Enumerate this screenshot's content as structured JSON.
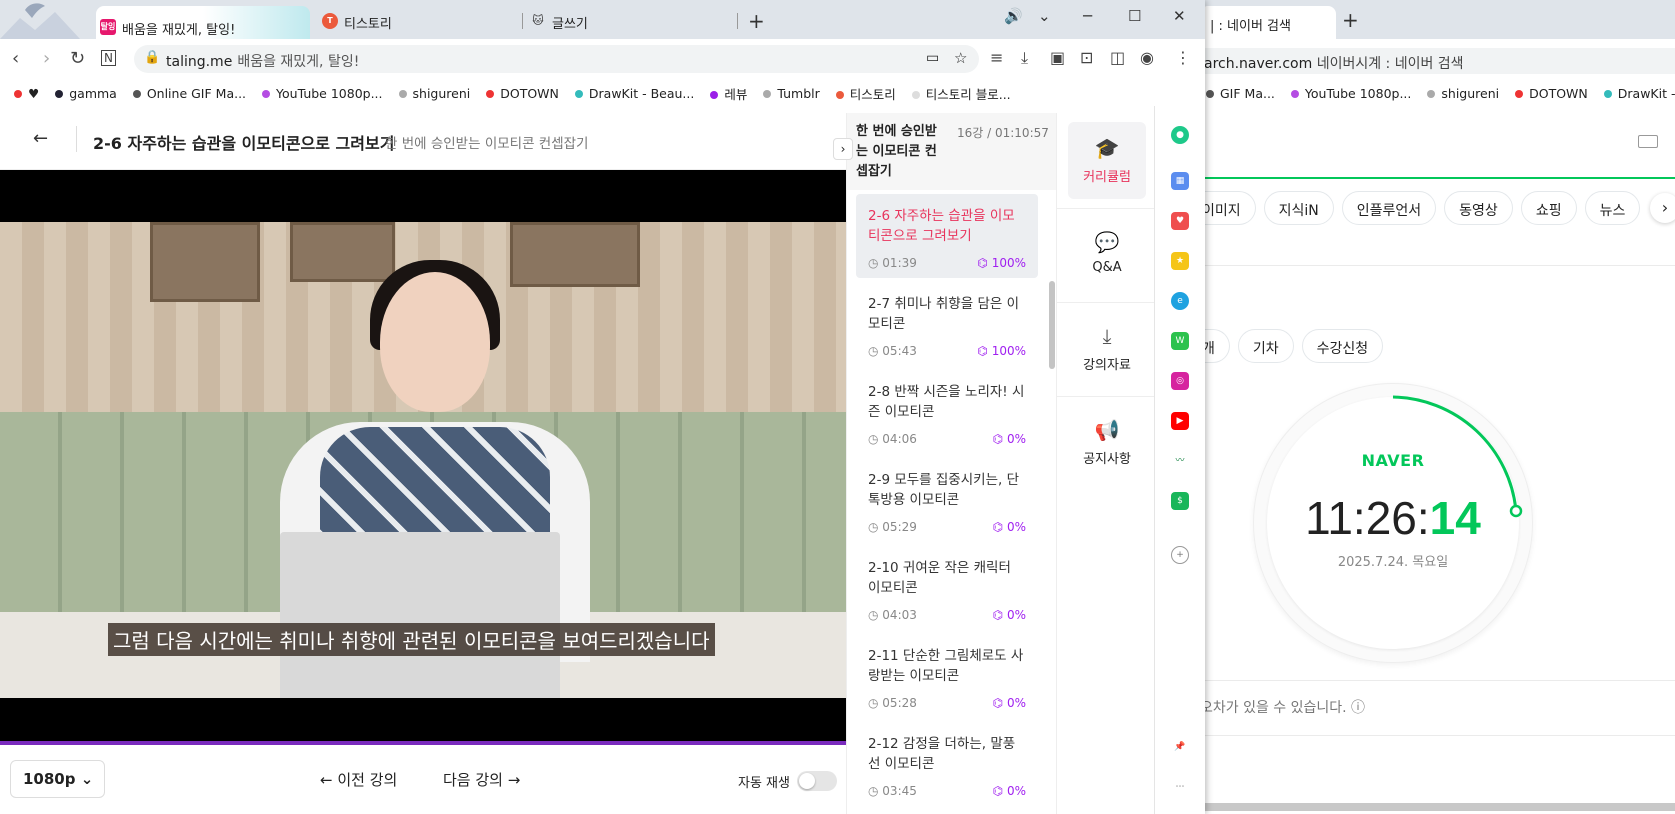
{
  "back_window": {
    "tab_title": "| : 네이버 검색",
    "url_host": "arch.naver.com",
    "url_title": "네이버시계 : 네이버 검색",
    "bookmarks": [
      {
        "label": "GIF Ma...",
        "color": "#555"
      },
      {
        "label": "YouTube 1080p...",
        "color": "#b54de3"
      },
      {
        "label": "shigureni",
        "color": "#aaa"
      },
      {
        "label": "DOTOWN",
        "color": "#e33"
      },
      {
        "label": "DrawKit - Beau...",
        "color": "#3bb"
      }
    ],
    "search_tabs": [
      "이미지",
      "지식iN",
      "인플루언서",
      "동영상",
      "쇼핑",
      "뉴스"
    ],
    "chips2": [
      "개",
      "기차",
      "수강신청"
    ],
    "clock": {
      "brand": "NAVER",
      "hm": "11:26:",
      "sec": "14",
      "date": "2025.7.24. 목요일"
    },
    "notice": "오차가 있을 수 있습니다. ⓘ"
  },
  "tabs": [
    {
      "label": "배움을 재밌게, 탈잉!",
      "fav": "탈잉",
      "color": "#e6186d"
    },
    {
      "label": "티스토리",
      "fav": "T",
      "color": "#eb5a3c"
    },
    {
      "label": "글쓰기",
      "fav": "🐱",
      "color": "#fff"
    }
  ],
  "addr": {
    "host": "taling.me",
    "title": "배움을 재밌게, 탈잉!"
  },
  "bookmarks": [
    {
      "label": "",
      "color": "#e33"
    },
    {
      "label": "♥",
      "color": "#222"
    },
    {
      "label": "gamma",
      "color": "#222"
    },
    {
      "label": "Online GIF Ma...",
      "color": "#555"
    },
    {
      "label": "YouTube 1080p...",
      "color": "#b54de3"
    },
    {
      "label": "shigureni",
      "color": "#aaa"
    },
    {
      "label": "DOTOWN",
      "color": "#e33"
    },
    {
      "label": "DrawKit - Beau...",
      "color": "#3bb"
    },
    {
      "label": "레뷰",
      "color": "#9b1fe8"
    },
    {
      "label": "Tumblr",
      "color": "#aaa"
    },
    {
      "label": "티스토리",
      "color": "#eb5a3c"
    },
    {
      "label": "티스토리 블로...",
      "color": "#ddd"
    }
  ],
  "lecture": {
    "title": "2-6 자주하는 습관을 이모티콘으로 그려보기",
    "subtitle": "한 번에 승인받는 이모티콘 컨셉잡기",
    "caption": "그럼 다음 시간에는 취미나 취향에 관련된 이모티콘을 보여드리겠습니다",
    "quality": "1080p",
    "prev": "이전 강의",
    "next": "다음 강의",
    "autoplay": "자동 재생"
  },
  "lesson_panel": {
    "course": "한 번에 승인받는 이모티콘 컨셉잡기",
    "count": "16강 / 01:10:57",
    "lessons": [
      {
        "title": "2-6 자주하는 습관을 이모티콘으로 그려보기",
        "time": "01:39",
        "pct": "100%"
      },
      {
        "title": "2-7 취미나 취향을 담은 이모티콘",
        "time": "05:43",
        "pct": "100%"
      },
      {
        "title": "2-8 반짝 시즌을 노리자! 시즌 이모티콘",
        "time": "04:06",
        "pct": "0%"
      },
      {
        "title": "2-9 모두를 집중시키는, 단톡방용 이모티콘",
        "time": "05:29",
        "pct": "0%"
      },
      {
        "title": "2-10 귀여운 작은 캐릭터 이모티콘",
        "time": "04:03",
        "pct": "0%"
      },
      {
        "title": "2-11 단순한 그림체로도 사랑받는 이모티콘",
        "time": "05:28",
        "pct": "0%"
      },
      {
        "title": "2-12 감정을 더하는, 말풍선 이모티콘",
        "time": "03:45",
        "pct": "0%"
      }
    ]
  },
  "tools": {
    "curriculum": "커리큘럼",
    "qa": "Q&A",
    "materials": "강의자료",
    "notice": "공지사항"
  }
}
